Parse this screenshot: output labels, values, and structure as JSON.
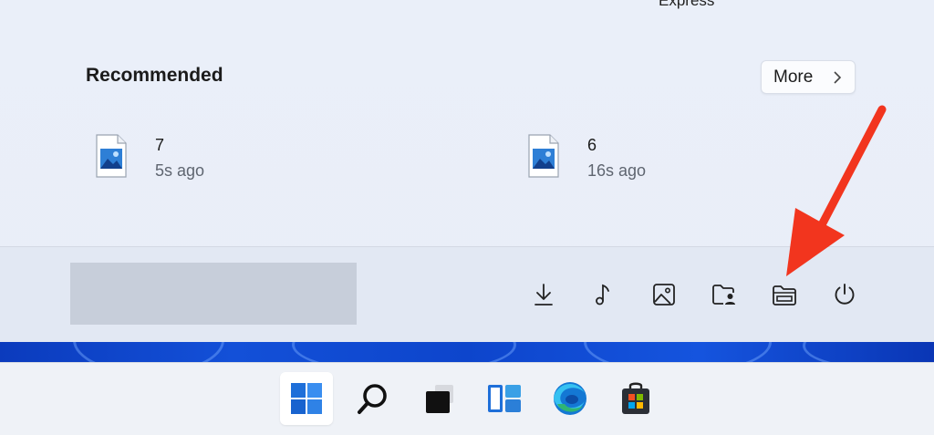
{
  "pinned_remnant": "Express",
  "recommended": {
    "title": "Recommended",
    "more_label": "More",
    "items": [
      {
        "name": "7",
        "time": "5s ago"
      },
      {
        "name": "6",
        "time": "16s ago"
      }
    ]
  },
  "footer": {
    "icons": [
      "download-icon",
      "music-icon",
      "pictures-icon",
      "user-folder-icon",
      "file-explorer-icon",
      "power-icon"
    ]
  },
  "taskbar": {
    "icons": [
      "windows-start-icon",
      "search-icon",
      "task-view-icon",
      "widgets-icon",
      "edge-icon",
      "store-icon"
    ]
  },
  "colors": {
    "arrow": "#f2351e",
    "accent_blue": "#1e6fd9",
    "wallpaper": "#1350d8"
  }
}
